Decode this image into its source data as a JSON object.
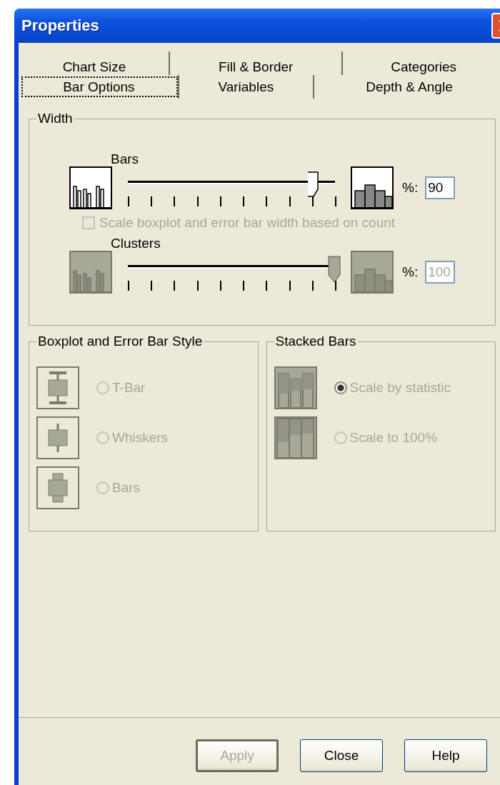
{
  "window": {
    "title": "Properties"
  },
  "tab_rows": [
    [
      {
        "label": "Chart Size",
        "selected": false
      },
      {
        "label": "Fill & Border",
        "selected": false
      },
      {
        "label": "Categories",
        "selected": false
      }
    ],
    [
      {
        "label": "Bar Options",
        "selected": true
      },
      {
        "label": "Variables",
        "selected": false
      },
      {
        "label": "Depth & Angle",
        "selected": false
      }
    ]
  ],
  "width_group": {
    "title": "Width",
    "rows": [
      {
        "kind": "slider",
        "label": "Bars",
        "level": 0.9,
        "percent_label": "%:",
        "value": "90",
        "disabled": false
      },
      {
        "kind": "checkbox",
        "label": "Scale boxplot and error bar width based on count",
        "checked": false,
        "disabled": true
      },
      {
        "kind": "slider",
        "label": "Clusters",
        "level": 1,
        "percent_label": "%:",
        "value": "100",
        "disabled": true
      }
    ]
  },
  "boxplot_group": {
    "title": "Boxplot and Error Bar Style",
    "options": [
      {
        "kind": "tbar",
        "label": "T-Bar",
        "selected": false,
        "disabled": true
      },
      {
        "kind": "whiskers",
        "label": "Whiskers",
        "selected": false,
        "disabled": true
      },
      {
        "kind": "bars",
        "label": "Bars",
        "selected": false,
        "disabled": true
      }
    ]
  },
  "stacked_group": {
    "title": "Stacked Bars",
    "options": [
      {
        "kind": "statistic",
        "label": "Scale by statistic",
        "selected": true,
        "disabled": true
      },
      {
        "kind": "percent",
        "label": "Scale to 100%",
        "selected": false,
        "disabled": true
      }
    ]
  },
  "buttons": [
    {
      "label": "Apply",
      "disabled": true,
      "default": true
    },
    {
      "label": "Close",
      "disabled": false,
      "default": false
    },
    {
      "label": "Help",
      "disabled": false,
      "default": false
    }
  ]
}
